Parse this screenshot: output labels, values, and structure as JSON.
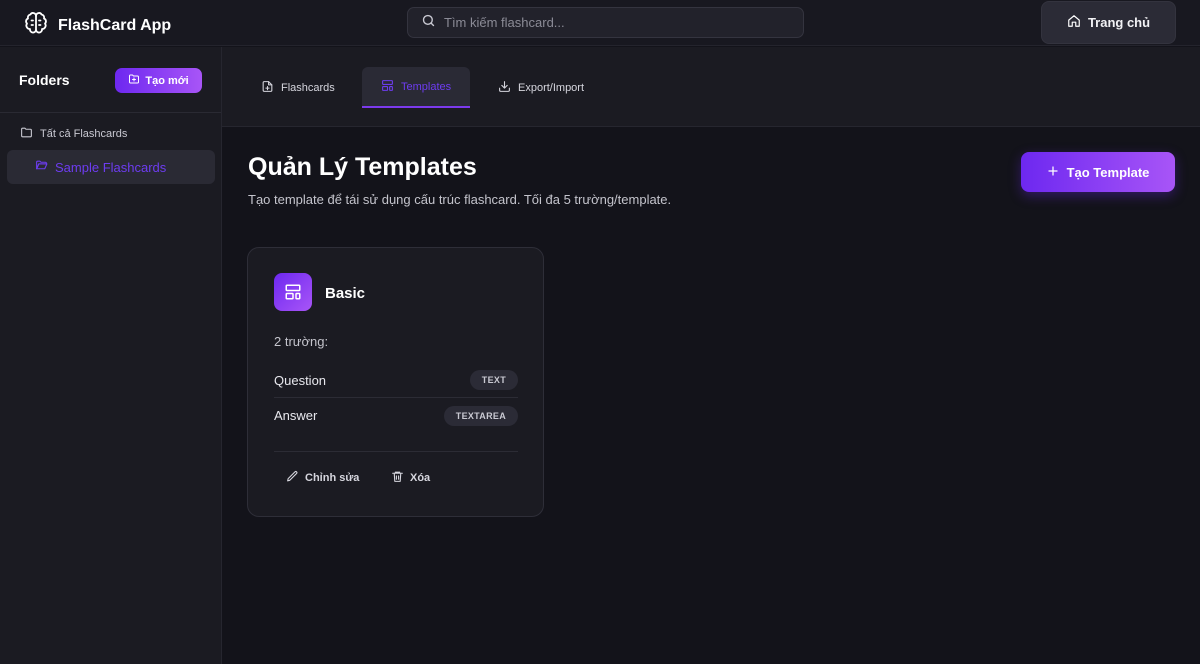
{
  "app": {
    "title": "FlashCard App"
  },
  "header": {
    "search_placeholder": "Tìm kiếm flashcard...",
    "home_label": "Trang chủ"
  },
  "sidebar": {
    "title": "Folders",
    "new_label": "Tạo mới",
    "items": [
      {
        "label": "Tất cả Flashcards",
        "active": false
      },
      {
        "label": "Sample Flashcards",
        "active": true
      }
    ]
  },
  "tabs": [
    {
      "label": "Flashcards",
      "active": false
    },
    {
      "label": "Templates",
      "active": true
    },
    {
      "label": "Export/Import",
      "active": false
    }
  ],
  "main": {
    "title": "Quản Lý Templates",
    "subtitle": "Tạo template để tái sử dụng cấu trúc flashcard. Tối đa 5 trường/template.",
    "create_label": "Tạo Template"
  },
  "templates": [
    {
      "name": "Basic",
      "field_count": "2 trường:",
      "fields": [
        {
          "name": "Question",
          "type": "TEXT"
        },
        {
          "name": "Answer",
          "type": "TEXTAREA"
        }
      ],
      "edit_label": "Chỉnh sửa",
      "delete_label": "Xóa"
    }
  ],
  "colors": {
    "accent": "#6d28f0",
    "accent_gradient_end": "#a855f7",
    "background": "#13131a",
    "panel": "#1b1b22"
  }
}
